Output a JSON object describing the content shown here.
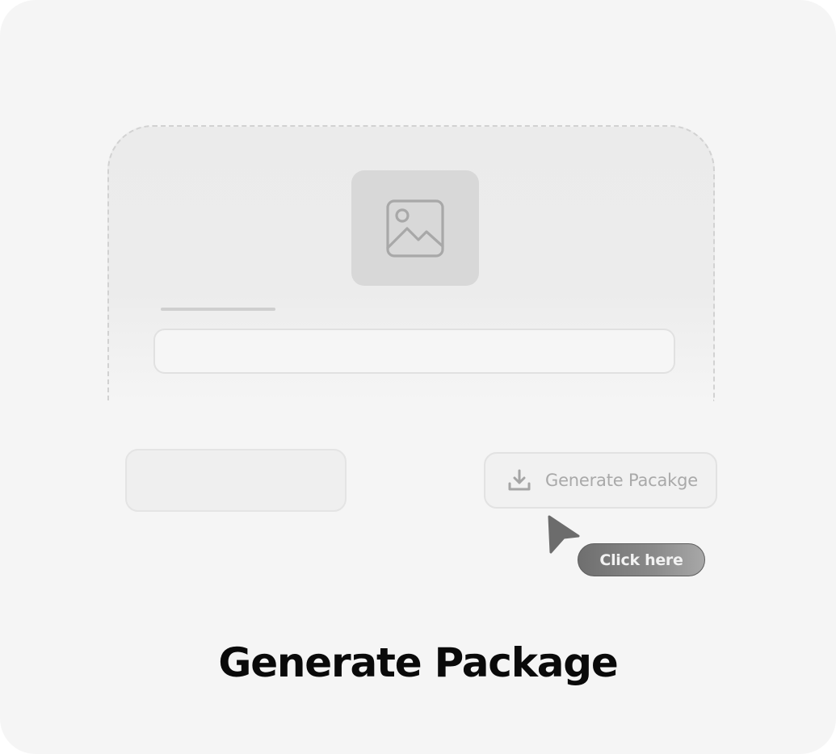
{
  "upload": {
    "image_icon": "image-placeholder-icon",
    "input_value": ""
  },
  "actions": {
    "secondary_label": "",
    "generate_label": "Generate Pacakge",
    "generate_icon": "download-icon"
  },
  "pointer": {
    "icon": "cursor-arrow-icon",
    "tooltip": "Click here"
  },
  "title": "Generate Package",
  "colors": {
    "background": "#f5f5f5",
    "panel": "#ececec",
    "placeholder": "#d8d8d8",
    "tooltip": "#7a7a7a",
    "title": "#0a0a0a"
  }
}
